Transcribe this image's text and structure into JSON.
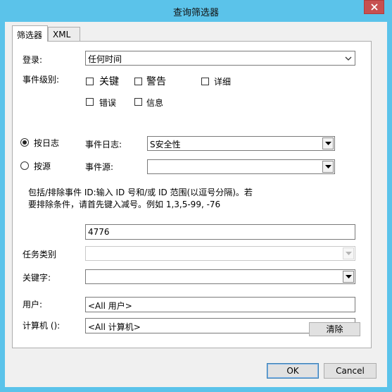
{
  "window": {
    "title": "查询筛选器"
  },
  "tabs": [
    {
      "label": "筛选器",
      "active": true
    },
    {
      "label": "XML",
      "active": false
    }
  ],
  "filter": {
    "logged_label": "登录:",
    "logged_value": "任何时间",
    "event_level_label": "事件级别:",
    "levels": {
      "critical": {
        "label": "关键",
        "checked": false
      },
      "warning": {
        "label": "警告",
        "checked": false
      },
      "verbose": {
        "label": "详细",
        "checked": false
      },
      "error": {
        "label": "错误",
        "checked": false
      },
      "information": {
        "label": "信息",
        "checked": false
      }
    },
    "by_log": {
      "label": "按日志",
      "selected": true
    },
    "by_source": {
      "label": "按源",
      "selected": false
    },
    "event_logs_label": "事件日志:",
    "event_logs_value": "S安全性",
    "event_sources_label": "事件源:",
    "event_sources_value": "",
    "description_line1": "包括/排除事件 ID:输入 ID 号和/或 ID 范围(以逗号分隔)。若",
    "description_line2": "要排除条件，请首先键入减号。例如 1,3,5-99, -76",
    "event_ids_value": "4776",
    "task_category_label": "任务类别",
    "task_category_value": "",
    "keywords_label": "关键字:",
    "keywords_value": "",
    "user_label": "用户:",
    "user_value": "<All 用户>",
    "computer_label": "计算机 ():",
    "computer_value": "<All 计算机>",
    "clear_label": "清除"
  },
  "dialog_buttons": {
    "ok_label": "OK",
    "cancel_label": "Cancel"
  }
}
